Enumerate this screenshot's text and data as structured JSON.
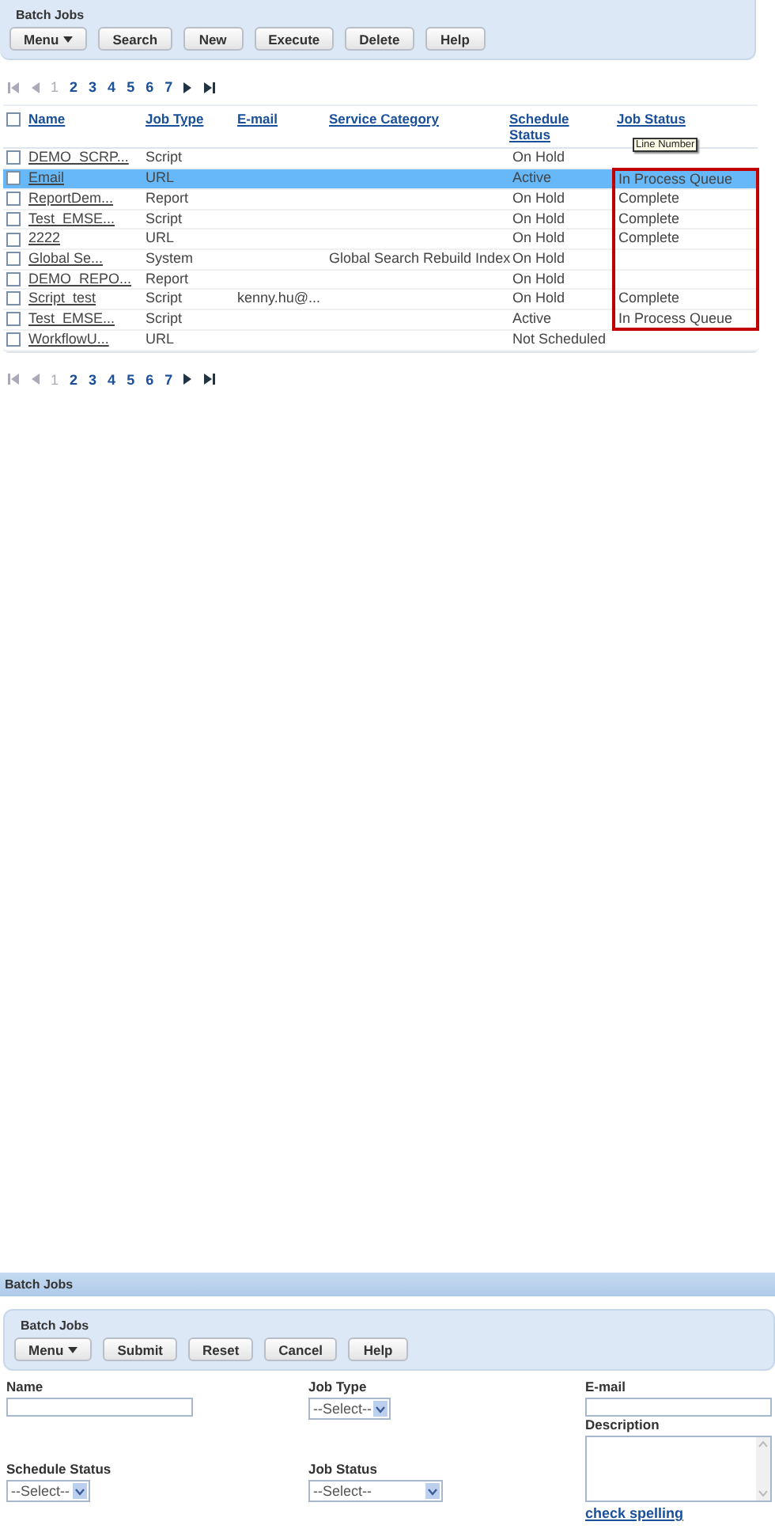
{
  "list_panel": {
    "title": "Batch Jobs",
    "buttons": [
      {
        "label": "Menu",
        "kind": "menu"
      },
      {
        "label": "Search",
        "kind": "plain"
      },
      {
        "label": "New",
        "kind": "plain"
      },
      {
        "label": "Execute",
        "kind": "plain"
      },
      {
        "label": "Delete",
        "kind": "plain"
      },
      {
        "label": "Help",
        "kind": "plain"
      }
    ]
  },
  "pager_top": {
    "pages": [
      {
        "label": "1",
        "selected": true
      },
      {
        "label": "2",
        "selected": false
      },
      {
        "label": "3",
        "selected": false
      },
      {
        "label": "4",
        "selected": false
      },
      {
        "label": "5",
        "selected": false
      },
      {
        "label": "6",
        "selected": false
      },
      {
        "label": "7",
        "selected": false
      }
    ]
  },
  "table": {
    "columns": [
      "Name",
      "Job Type",
      "E-mail",
      "Service Category",
      "Schedule Status",
      "Job Status"
    ],
    "tooltip": "Line Number",
    "select_all_checked": false,
    "rows": [
      {
        "checked": false,
        "selected": false,
        "outlined": false,
        "cells": [
          "DEMO_SCRP...",
          "Script",
          "",
          "",
          "On Hold",
          ""
        ]
      },
      {
        "checked": false,
        "selected": true,
        "outlined": true,
        "cells": [
          "Email",
          "URL",
          "",
          "",
          "Active",
          "In Process Queue"
        ]
      },
      {
        "checked": false,
        "selected": false,
        "outlined": true,
        "cells": [
          "ReportDem...",
          "Report",
          "",
          "",
          "On Hold",
          "Complete"
        ]
      },
      {
        "checked": false,
        "selected": false,
        "outlined": true,
        "cells": [
          "Test_EMSE...",
          "Script",
          "",
          "",
          "On Hold",
          "Complete"
        ]
      },
      {
        "checked": false,
        "selected": false,
        "outlined": true,
        "cells": [
          "2222",
          "URL",
          "",
          "",
          "On Hold",
          "Complete"
        ]
      },
      {
        "checked": false,
        "selected": false,
        "outlined": true,
        "cells": [
          "Global Se...",
          "System",
          "",
          "Global Search Rebuild Index",
          "On Hold",
          ""
        ]
      },
      {
        "checked": false,
        "selected": false,
        "outlined": true,
        "cells": [
          "DEMO_REPO...",
          "Report",
          "",
          "",
          "On Hold",
          ""
        ]
      },
      {
        "checked": false,
        "selected": false,
        "outlined": true,
        "cells": [
          "Script_test",
          "Script",
          "kenny.hu@...",
          "",
          "On Hold",
          "Complete"
        ]
      },
      {
        "checked": false,
        "selected": false,
        "outlined": true,
        "cells": [
          "Test_EMSE...",
          "Script",
          "",
          "",
          "Active",
          "In Process Queue"
        ]
      },
      {
        "checked": false,
        "selected": false,
        "outlined": false,
        "cells": [
          "WorkflowU...",
          "URL",
          "",
          "",
          "Not Scheduled",
          ""
        ]
      }
    ]
  },
  "pager_bottom": {
    "pages": [
      {
        "label": "1",
        "selected": true
      },
      {
        "label": "2",
        "selected": false
      },
      {
        "label": "3",
        "selected": false
      },
      {
        "label": "4",
        "selected": false
      },
      {
        "label": "5",
        "selected": false
      },
      {
        "label": "6",
        "selected": false
      },
      {
        "label": "7",
        "selected": false
      }
    ]
  },
  "detail_bar": {
    "title": "Batch Jobs"
  },
  "detail_panel": {
    "title": "Batch Jobs",
    "buttons": [
      {
        "label": "Menu",
        "kind": "menu"
      },
      {
        "label": "Submit",
        "kind": "plain"
      },
      {
        "label": "Reset",
        "kind": "plain"
      },
      {
        "label": "Cancel",
        "kind": "plain"
      },
      {
        "label": "Help",
        "kind": "plain"
      }
    ]
  },
  "form": {
    "name": {
      "label": "Name"
    },
    "job_type": {
      "label": "Job Type",
      "value": "--Select--"
    },
    "email": {
      "label": "E-mail"
    },
    "description": {
      "label": "Description",
      "link": "check spelling"
    },
    "schedule_status": {
      "label": "Schedule Status",
      "value": "--Select--"
    },
    "job_status": {
      "label": "Job Status",
      "value": "--Select--"
    }
  }
}
